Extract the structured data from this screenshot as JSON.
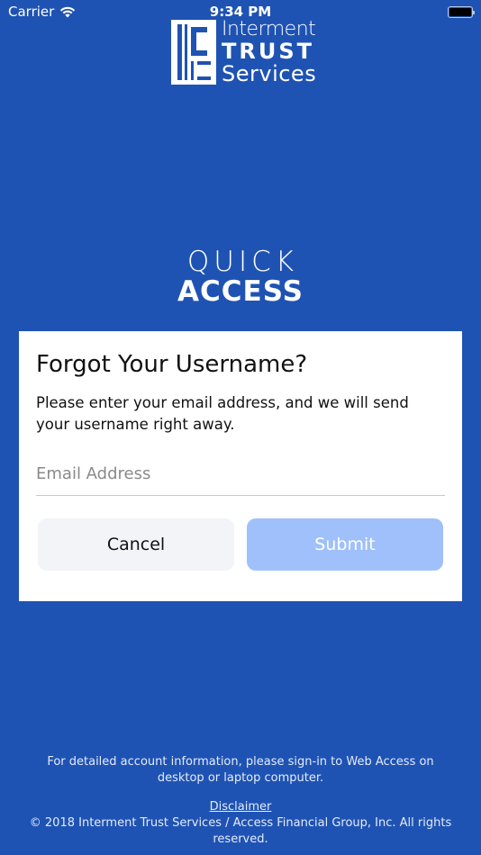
{
  "status_bar": {
    "carrier": "Carrier",
    "time": "9:34 PM",
    "icons": [
      "wifi-icon",
      "battery-icon"
    ]
  },
  "logo": {
    "line1": "Interment",
    "line2": "TRUST",
    "line3": "Services"
  },
  "quick_access": {
    "line1": "QUICK",
    "line2": "ACCESS"
  },
  "card": {
    "title": "Forgot Your Username?",
    "description": "Please enter your email address, and we will send your username right away.",
    "email_placeholder": "Email Address",
    "email_value": "",
    "cancel_label": "Cancel",
    "submit_label": "Submit"
  },
  "footer": {
    "info": "For detailed account information, please sign-in to Web Access on desktop or laptop computer.",
    "disclaimer": "Disclaimer",
    "copyright": "© 2018 Interment Trust Services / Access Financial Group, Inc. All rights reserved."
  },
  "colors": {
    "background": "#1f53b3",
    "card": "#ffffff",
    "submit_disabled": "#9fc0fb",
    "cancel_bg": "#f2f4f7"
  }
}
